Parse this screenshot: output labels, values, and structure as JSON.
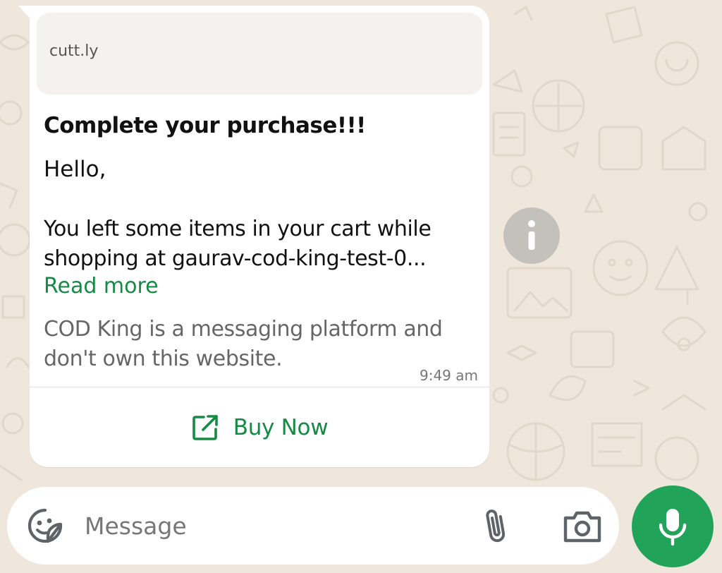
{
  "chat": {
    "message": {
      "link_preview_domain": "cutt.ly",
      "title": "Complete your purchase!!!",
      "greeting": "Hello,",
      "body": "You left some items in your cart while shopping at gaurav-cod-king-test-0...",
      "read_more_label": "Read more",
      "disclaimer": "COD King is a messaging platform and don't own this website.",
      "time": "9:49 am",
      "cta_label": "Buy Now",
      "cta_icon": "external-link-icon"
    },
    "info_icon": "info-icon"
  },
  "composer": {
    "placeholder": "Message",
    "value": "",
    "icons": {
      "sticker": "sticker-icon",
      "attach": "paperclip-icon",
      "camera": "camera-icon",
      "mic": "mic-icon"
    }
  },
  "colors": {
    "accent_green": "#168a45",
    "mic_button": "#22a35a",
    "wallpaper": "#efe7dc",
    "bubble": "#ffffff"
  }
}
